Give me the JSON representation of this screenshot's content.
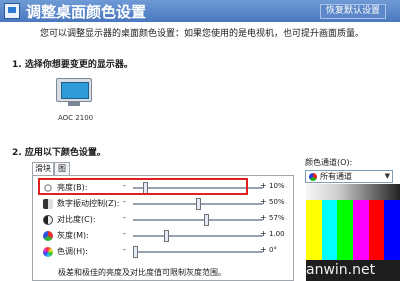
{
  "header": {
    "title": "调整桌面颜色设置",
    "restore_label": "恢复默认设置"
  },
  "intro_text": "您可以调整显示器的桌面颜色设置：如果您使用的是电视机，也可提升画面质量。",
  "section1": {
    "title": "1. 选择你想要变更的显示器。",
    "monitor_label": "AOC 2100"
  },
  "section2": {
    "title": "2. 应用以下颜色设置。"
  },
  "tabs": [
    {
      "label": "滑块"
    },
    {
      "label": "图"
    }
  ],
  "adjustments": [
    {
      "label": "亮度(B):",
      "icon": "sun-icon",
      "value": "10%",
      "level": 0.08
    },
    {
      "label": "数字振动控制(Z):",
      "icon": "vibrance-icon",
      "value": "50%",
      "level": 0.5
    },
    {
      "label": "对比度(C):",
      "icon": "contrast-icon",
      "value": "57%",
      "level": 0.57
    },
    {
      "label": "灰度(M):",
      "icon": "gamma-icon",
      "value": "1.00",
      "level": 0.25
    },
    {
      "label": "色调(H):",
      "icon": "hue-icon",
      "value": "0°",
      "level": 0.0
    }
  ],
  "note_text": "极差和极佳的亮度及对比度值可限制灰度范围。",
  "color_channel": {
    "label": "颜色通道(O):",
    "selected": "所有通道"
  },
  "colors": {
    "header": "#4a78c0",
    "highlight": "#e02020",
    "test_bars": [
      "#ffff00",
      "#00ffff",
      "#00ff00",
      "#ff00ff",
      "#ff0000",
      "#0000ff"
    ]
  },
  "watermark": "anwin.net"
}
